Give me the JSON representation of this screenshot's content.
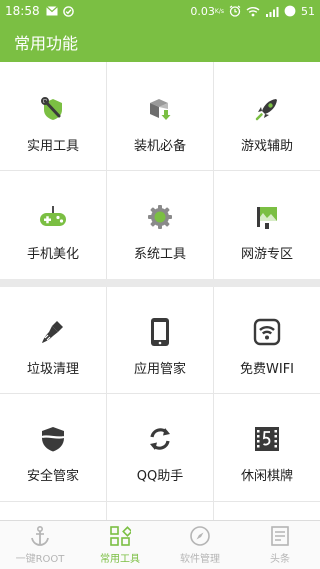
{
  "status_bar": {
    "time": "18:58",
    "net_speed": "0.03",
    "net_unit": "K/s",
    "battery": "51"
  },
  "app_bar": {
    "title": "常用功能"
  },
  "section1": {
    "items": [
      {
        "label": "实用工具",
        "icon": "wrench-shield-icon"
      },
      {
        "label": "装机必备",
        "icon": "box-download-icon"
      },
      {
        "label": "游戏辅助",
        "icon": "rocket-icon"
      },
      {
        "label": "手机美化",
        "icon": "gamepad-icon"
      },
      {
        "label": "系统工具",
        "icon": "gear-icon"
      },
      {
        "label": "网游专区",
        "icon": "landscape-flag-icon"
      }
    ]
  },
  "section2": {
    "items": [
      {
        "label": "垃圾清理",
        "icon": "brush-icon"
      },
      {
        "label": "应用管家",
        "icon": "phone-icon"
      },
      {
        "label": "免费WIFI",
        "icon": "wifi-icon"
      },
      {
        "label": "安全管家",
        "icon": "shield-icon"
      },
      {
        "label": "QQ助手",
        "icon": "sync-icon"
      },
      {
        "label": "休闲棋牌",
        "icon": "film-card-icon"
      }
    ]
  },
  "tabs": [
    {
      "label": "一键ROOT",
      "icon": "anchor-icon",
      "active": false
    },
    {
      "label": "常用工具",
      "icon": "grid-diamond-icon",
      "active": true
    },
    {
      "label": "软件管理",
      "icon": "compass-icon",
      "active": false
    },
    {
      "label": "头条",
      "icon": "news-icon",
      "active": false
    }
  ],
  "colors": {
    "accent": "#7bbf43",
    "icon_dark": "#3a3a3a",
    "tab_inactive": "#b5b5b5"
  }
}
